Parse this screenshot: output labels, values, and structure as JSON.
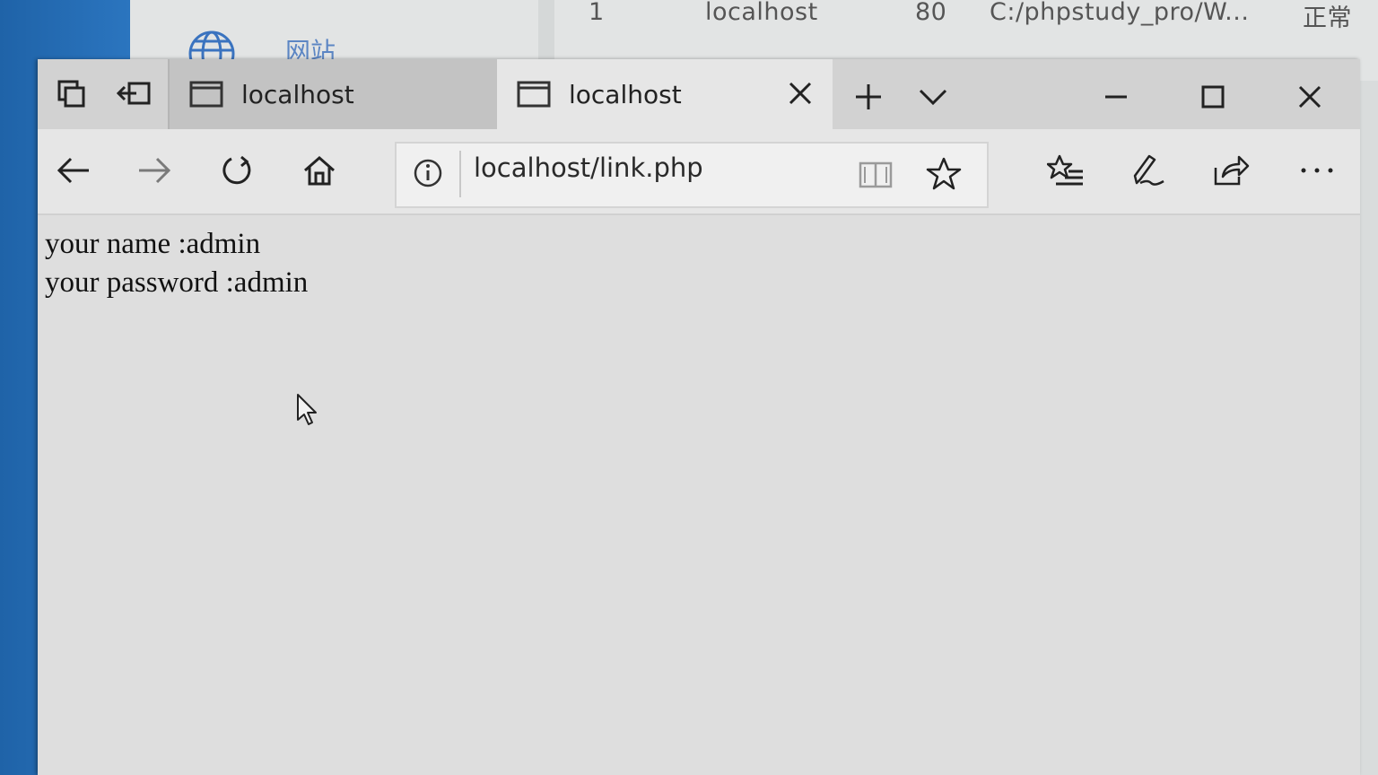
{
  "background_app": {
    "row": {
      "index": "1",
      "host": "localhost",
      "port": "80",
      "path": "C:/phpstudy_pro/W...",
      "status": "正常"
    },
    "nav_label": "网站",
    "icons": {
      "globe": "globe-icon"
    }
  },
  "browser": {
    "titlebar": {
      "set_aside_icon": "tabs-aside-icon",
      "restore_icon": "restore-tabs-icon",
      "tabs": [
        {
          "label": "localhost",
          "active": false,
          "icon": "page-icon"
        },
        {
          "label": "localhost",
          "active": true,
          "icon": "page-icon"
        }
      ],
      "new_tab_icon": "plus-icon",
      "tab_list_icon": "chevron-down-icon",
      "window_controls": [
        "minimize-icon",
        "maximize-icon",
        "close-icon"
      ]
    },
    "navbar": {
      "back_icon": "arrow-left-icon",
      "forward_icon": "arrow-right-icon",
      "refresh_icon": "refresh-icon",
      "home_icon": "home-icon",
      "address": {
        "info_icon": "info-icon",
        "url": "localhost/link.php",
        "reading_view_icon": "book-icon",
        "favorite_icon": "star-icon"
      },
      "favorites_hub_icon": "favorites-list-icon",
      "notes_icon": "pen-icon",
      "share_icon": "share-icon",
      "more_icon": "more-icon"
    },
    "page": {
      "lines": [
        "your name :admin",
        "your password :admin"
      ]
    }
  },
  "colors": {
    "desktop_blue": "#2468b0",
    "titlebar": "#d2d2d2",
    "active_tab": "#e6e6e6",
    "inactive_tab": "#c3c3c3",
    "content_bg": "#dedede"
  }
}
